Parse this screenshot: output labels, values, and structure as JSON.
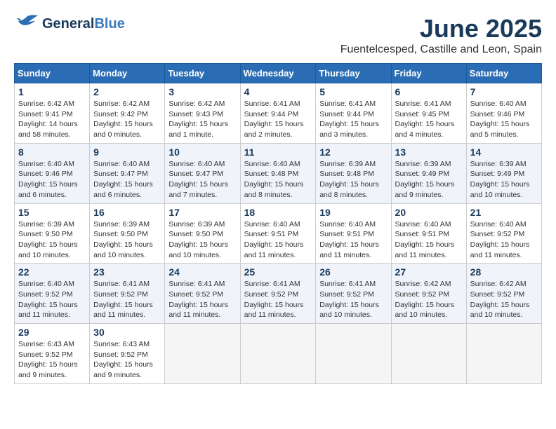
{
  "header": {
    "logo_general": "General",
    "logo_blue": "Blue",
    "month": "June 2025",
    "location": "Fuentelcesped, Castille and Leon, Spain"
  },
  "days_of_week": [
    "Sunday",
    "Monday",
    "Tuesday",
    "Wednesday",
    "Thursday",
    "Friday",
    "Saturday"
  ],
  "weeks": [
    [
      {
        "day": "1",
        "sunrise": "6:42 AM",
        "sunset": "9:41 PM",
        "daylight": "14 hours and 58 minutes."
      },
      {
        "day": "2",
        "sunrise": "6:42 AM",
        "sunset": "9:42 PM",
        "daylight": "15 hours and 0 minutes."
      },
      {
        "day": "3",
        "sunrise": "6:42 AM",
        "sunset": "9:43 PM",
        "daylight": "15 hours and 1 minute."
      },
      {
        "day": "4",
        "sunrise": "6:41 AM",
        "sunset": "9:44 PM",
        "daylight": "15 hours and 2 minutes."
      },
      {
        "day": "5",
        "sunrise": "6:41 AM",
        "sunset": "9:44 PM",
        "daylight": "15 hours and 3 minutes."
      },
      {
        "day": "6",
        "sunrise": "6:41 AM",
        "sunset": "9:45 PM",
        "daylight": "15 hours and 4 minutes."
      },
      {
        "day": "7",
        "sunrise": "6:40 AM",
        "sunset": "9:46 PM",
        "daylight": "15 hours and 5 minutes."
      }
    ],
    [
      {
        "day": "8",
        "sunrise": "6:40 AM",
        "sunset": "9:46 PM",
        "daylight": "15 hours and 6 minutes."
      },
      {
        "day": "9",
        "sunrise": "6:40 AM",
        "sunset": "9:47 PM",
        "daylight": "15 hours and 6 minutes."
      },
      {
        "day": "10",
        "sunrise": "6:40 AM",
        "sunset": "9:47 PM",
        "daylight": "15 hours and 7 minutes."
      },
      {
        "day": "11",
        "sunrise": "6:40 AM",
        "sunset": "9:48 PM",
        "daylight": "15 hours and 8 minutes."
      },
      {
        "day": "12",
        "sunrise": "6:39 AM",
        "sunset": "9:48 PM",
        "daylight": "15 hours and 8 minutes."
      },
      {
        "day": "13",
        "sunrise": "6:39 AM",
        "sunset": "9:49 PM",
        "daylight": "15 hours and 9 minutes."
      },
      {
        "day": "14",
        "sunrise": "6:39 AM",
        "sunset": "9:49 PM",
        "daylight": "15 hours and 10 minutes."
      }
    ],
    [
      {
        "day": "15",
        "sunrise": "6:39 AM",
        "sunset": "9:50 PM",
        "daylight": "15 hours and 10 minutes."
      },
      {
        "day": "16",
        "sunrise": "6:39 AM",
        "sunset": "9:50 PM",
        "daylight": "15 hours and 10 minutes."
      },
      {
        "day": "17",
        "sunrise": "6:39 AM",
        "sunset": "9:50 PM",
        "daylight": "15 hours and 10 minutes."
      },
      {
        "day": "18",
        "sunrise": "6:40 AM",
        "sunset": "9:51 PM",
        "daylight": "15 hours and 11 minutes."
      },
      {
        "day": "19",
        "sunrise": "6:40 AM",
        "sunset": "9:51 PM",
        "daylight": "15 hours and 11 minutes."
      },
      {
        "day": "20",
        "sunrise": "6:40 AM",
        "sunset": "9:51 PM",
        "daylight": "15 hours and 11 minutes."
      },
      {
        "day": "21",
        "sunrise": "6:40 AM",
        "sunset": "9:52 PM",
        "daylight": "15 hours and 11 minutes."
      }
    ],
    [
      {
        "day": "22",
        "sunrise": "6:40 AM",
        "sunset": "9:52 PM",
        "daylight": "15 hours and 11 minutes."
      },
      {
        "day": "23",
        "sunrise": "6:41 AM",
        "sunset": "9:52 PM",
        "daylight": "15 hours and 11 minutes."
      },
      {
        "day": "24",
        "sunrise": "6:41 AM",
        "sunset": "9:52 PM",
        "daylight": "15 hours and 11 minutes."
      },
      {
        "day": "25",
        "sunrise": "6:41 AM",
        "sunset": "9:52 PM",
        "daylight": "15 hours and 11 minutes."
      },
      {
        "day": "26",
        "sunrise": "6:41 AM",
        "sunset": "9:52 PM",
        "daylight": "15 hours and 10 minutes."
      },
      {
        "day": "27",
        "sunrise": "6:42 AM",
        "sunset": "9:52 PM",
        "daylight": "15 hours and 10 minutes."
      },
      {
        "day": "28",
        "sunrise": "6:42 AM",
        "sunset": "9:52 PM",
        "daylight": "15 hours and 10 minutes."
      }
    ],
    [
      {
        "day": "29",
        "sunrise": "6:43 AM",
        "sunset": "9:52 PM",
        "daylight": "15 hours and 9 minutes."
      },
      {
        "day": "30",
        "sunrise": "6:43 AM",
        "sunset": "9:52 PM",
        "daylight": "15 hours and 9 minutes."
      },
      null,
      null,
      null,
      null,
      null
    ]
  ]
}
